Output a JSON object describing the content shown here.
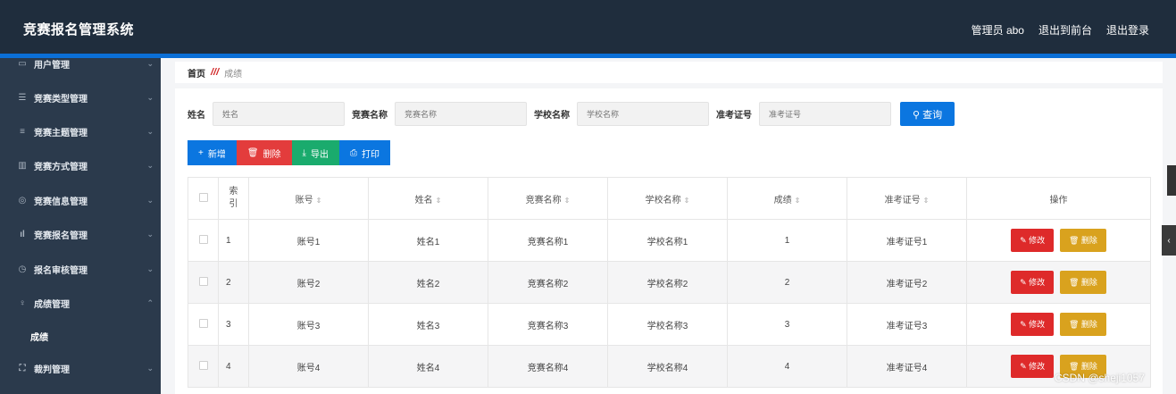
{
  "app": {
    "title": "竞赛报名管理系统",
    "user_label": "管理员 abo",
    "exit_front": "退出到前台",
    "logout": "退出登录"
  },
  "sidebar": {
    "items": [
      {
        "label": "用户管理",
        "icon": "user-icon"
      },
      {
        "label": "竞赛类型管理",
        "icon": "sliders-icon"
      },
      {
        "label": "竞赛主题管理",
        "icon": "menu-icon"
      },
      {
        "label": "竞赛方式管理",
        "icon": "trash-icon"
      },
      {
        "label": "竞赛信息管理",
        "icon": "compass-icon"
      },
      {
        "label": "竞赛报名管理",
        "icon": "bar-chart-icon"
      },
      {
        "label": "报名审核管理",
        "icon": "clock-icon"
      },
      {
        "label": "成绩管理",
        "icon": "bulb-icon"
      },
      {
        "label": "裁判管理",
        "icon": "scan-icon"
      }
    ],
    "sub_item": "成绩"
  },
  "breadcrumb": {
    "home": "首页",
    "separator": "///",
    "current": "成绩"
  },
  "filters": [
    {
      "label": "姓名",
      "placeholder": "姓名"
    },
    {
      "label": "竞赛名称",
      "placeholder": "竞赛名称"
    },
    {
      "label": "学校名称",
      "placeholder": "学校名称"
    },
    {
      "label": "准考证号",
      "placeholder": "准考证号"
    }
  ],
  "query_label": "查询",
  "actions": {
    "add": "新增",
    "delete": "删除",
    "export": "导出",
    "print": "打印"
  },
  "table": {
    "headers": {
      "index": "索引",
      "account": "账号",
      "name": "姓名",
      "contest": "竞赛名称",
      "school": "学校名称",
      "score": "成绩",
      "ticket": "准考证号",
      "ops": "操作"
    },
    "rows": [
      {
        "index": "1",
        "account": "账号1",
        "name": "姓名1",
        "contest": "竞赛名称1",
        "school": "学校名称1",
        "score": "1",
        "ticket": "准考证号1"
      },
      {
        "index": "2",
        "account": "账号2",
        "name": "姓名2",
        "contest": "竞赛名称2",
        "school": "学校名称2",
        "score": "2",
        "ticket": "准考证号2"
      },
      {
        "index": "3",
        "account": "账号3",
        "name": "姓名3",
        "contest": "竞赛名称3",
        "school": "学校名称3",
        "score": "3",
        "ticket": "准考证号3"
      },
      {
        "index": "4",
        "account": "账号4",
        "name": "姓名4",
        "contest": "竞赛名称4",
        "school": "学校名称4",
        "score": "4",
        "ticket": "准考证号4"
      }
    ],
    "edit_label": "修改",
    "del_label": "删除"
  },
  "watermark": "CSDN @sheji1057"
}
